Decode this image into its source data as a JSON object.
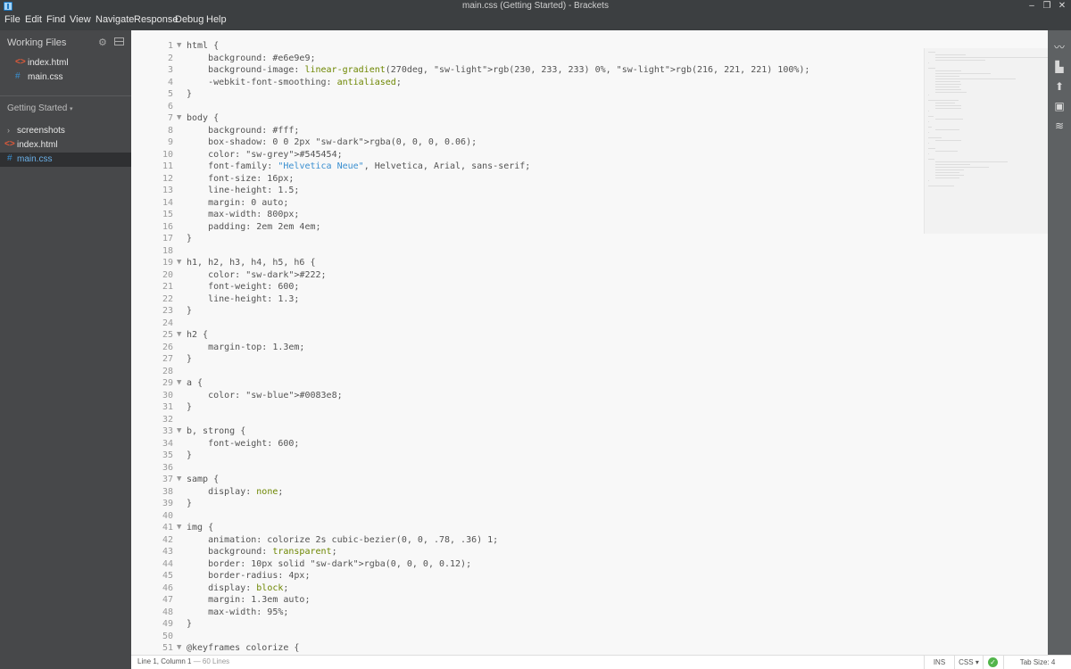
{
  "window": {
    "title": "main.css (Getting Started) - Brackets",
    "minimize": "‒",
    "restore": "❐",
    "close": "✕"
  },
  "menu": [
    "File",
    "Edit",
    "Find",
    "View",
    "Navigate",
    "Response",
    "Debug",
    "Help"
  ],
  "sidebar": {
    "working_files_label": "Working Files",
    "working_files": [
      {
        "name": "index.html",
        "icon": "html-file-icon"
      },
      {
        "name": "main.css",
        "icon": "css-file-icon"
      }
    ],
    "project_label": "Getting Started",
    "tree": [
      {
        "name": "screenshots",
        "type": "folder"
      },
      {
        "name": "index.html",
        "type": "html"
      },
      {
        "name": "main.css",
        "type": "css",
        "selected": true
      }
    ]
  },
  "editor": {
    "line_numbers": [
      "1",
      "2",
      "3",
      "4",
      "5",
      "6",
      "7",
      "8",
      "9",
      "10",
      "11",
      "12",
      "13",
      "14",
      "15",
      "16",
      "17",
      "18",
      "19",
      "20",
      "21",
      "22",
      "23",
      "24",
      "25",
      "26",
      "27",
      "28",
      "29",
      "30",
      "31",
      "32",
      "33",
      "34",
      "35",
      "36",
      "37",
      "38",
      "39",
      "40",
      "41",
      "42",
      "43",
      "44",
      "45",
      "46",
      "47",
      "48",
      "49",
      "50",
      "51"
    ],
    "code": [
      "html {",
      "    background: #e6e9e9;",
      "    background-image: linear-gradient(270deg, rgb(230, 233, 233) 0%, rgb(216, 221, 221) 100%);",
      "    -webkit-font-smoothing: antialiased;",
      "}",
      "",
      "body {",
      "    background: #fff;",
      "    box-shadow: 0 0 2px rgba(0, 0, 0, 0.06);",
      "    color: #545454;",
      "    font-family: \"Helvetica Neue\", Helvetica, Arial, sans-serif;",
      "    font-size: 16px;",
      "    line-height: 1.5;",
      "    margin: 0 auto;",
      "    max-width: 800px;",
      "    padding: 2em 2em 4em;",
      "}",
      "",
      "h1, h2, h3, h4, h5, h6 {",
      "    color: #222;",
      "    font-weight: 600;",
      "    line-height: 1.3;",
      "}",
      "",
      "h2 {",
      "    margin-top: 1.3em;",
      "}",
      "",
      "a {",
      "    color: #0083e8;",
      "}",
      "",
      "b, strong {",
      "    font-weight: 600;",
      "}",
      "",
      "samp {",
      "    display: none;",
      "}",
      "",
      "img {",
      "    animation: colorize 2s cubic-bezier(0, 0, .78, .36) 1;",
      "    background: transparent;",
      "    border: 10px solid rgba(0, 0, 0, 0.12);",
      "    border-radius: 4px;",
      "    display: block;",
      "    margin: 1.3em auto;",
      "    max-width: 95%;",
      "}",
      "",
      "@keyframes colorize {"
    ]
  },
  "status": {
    "cursor": "Line 1, Column 1",
    "lines": " — 60 Lines",
    "mode": "INS",
    "language": "CSS ▾",
    "tab_size": "Tab Size: 4"
  },
  "colors": {
    "chrome": "#3c3f41",
    "sidebar": "#47484a",
    "editor_bg": "#f8f8f8",
    "accent": "#0083e8"
  },
  "right_toolbar": [
    "live-preview-icon",
    "extension-manager-icon",
    "upload-icon",
    "device-icon",
    "layers-icon"
  ]
}
